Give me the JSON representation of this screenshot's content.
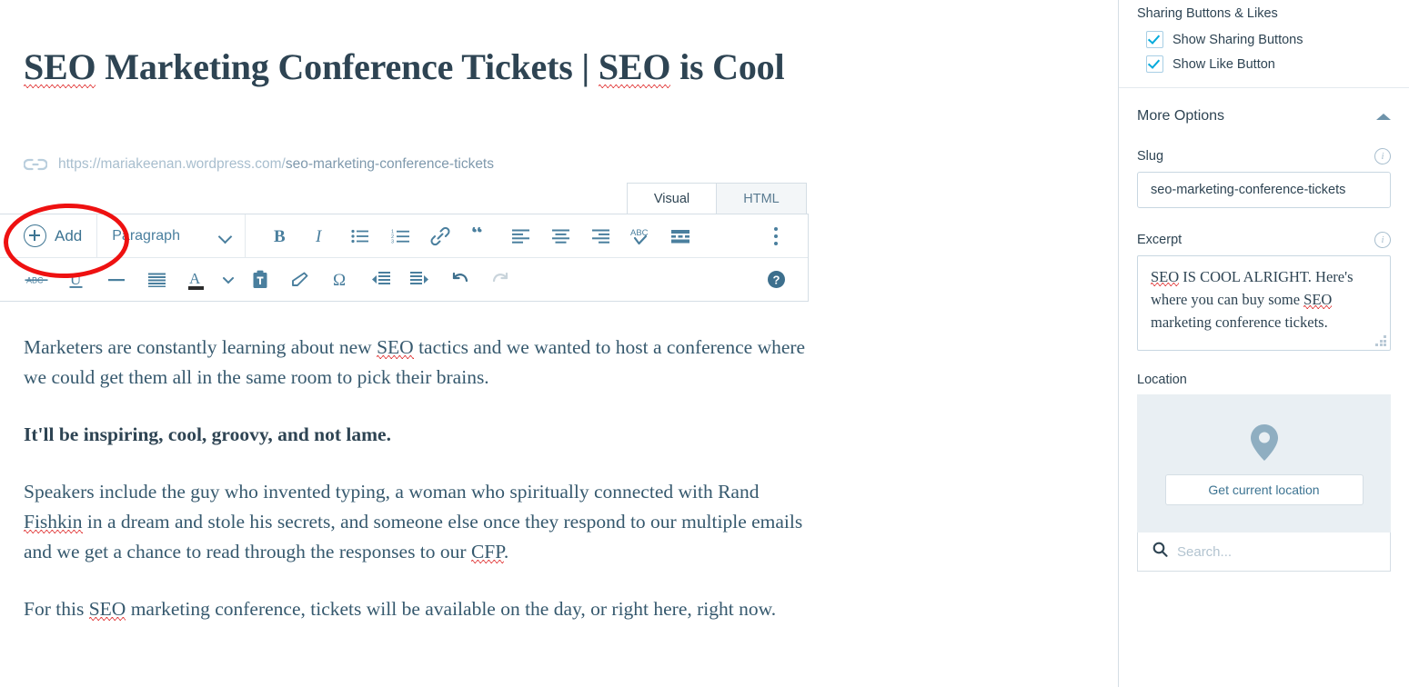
{
  "editor": {
    "title_line1": "SEO Marketing Conference Tickets | SEO",
    "title_line2": "is Cool",
    "title_full": "SEO Marketing Conference Tickets | SEO is Cool",
    "permalink_base": "https://mariakeenan.wordpress.com/",
    "permalink_slug": "seo-marketing-conference-tickets",
    "link_icon": "link-icon",
    "tabs": [
      {
        "label": "Visual",
        "active": true
      },
      {
        "label": "HTML",
        "active": false
      }
    ],
    "toolbar": {
      "add_label": "Add",
      "add_icon": "plus-circle-icon",
      "format_select_value": "Paragraph",
      "format_chevron_icon": "chevron-down-icon",
      "kebab_icon": "kebab-menu-icon",
      "help_icon": "help-icon",
      "row1_icons": [
        "bold-icon",
        "italic-icon",
        "bulleted-list-icon",
        "numbered-list-icon",
        "link-icon",
        "blockquote-icon",
        "align-left-icon",
        "align-center-icon",
        "align-right-icon",
        "spellcheck-icon",
        "insert-more-icon"
      ],
      "row2_icons": [
        "strikethrough-icon",
        "underline-icon",
        "horizontal-rule-icon",
        "justify-icon",
        "text-color-icon",
        "color-chevron-icon",
        "paste-icon",
        "clear-formatting-icon",
        "special-character-icon",
        "outdent-icon",
        "indent-icon",
        "undo-icon",
        "redo-icon"
      ]
    },
    "body_paragraphs": [
      {
        "text": "Marketers are constantly learning about new SEO tactics and we wanted to host a conference where we could get them all in the same room to pick their brains.",
        "bold": false
      },
      {
        "text": "It'll be inspiring, cool, groovy, and not lame.",
        "bold": true
      },
      {
        "text": "Speakers include the guy who invented typing, a woman who spiritually connected with Rand Fishkin in a dream and stole his secrets, and someone else once they respond to our multiple emails and we get a chance to read through the responses to our CFP.",
        "bold": false
      },
      {
        "text": "For this SEO marketing conference, tickets will be available on the day, or right here, right now.",
        "bold": false
      }
    ]
  },
  "annotation": {
    "shape": "ellipse",
    "color": "#ee1111",
    "targets": "add-button"
  },
  "sidebar": {
    "sharing": {
      "title": "Sharing Buttons & Likes",
      "options": [
        {
          "label": "Show Sharing Buttons",
          "checked": true
        },
        {
          "label": "Show Like Button",
          "checked": true
        }
      ]
    },
    "more_options": {
      "label": "More Options",
      "collapse_icon": "triangle-up-icon",
      "expanded": true
    },
    "slug": {
      "label": "Slug",
      "info_icon": "info-icon",
      "value": "seo-marketing-conference-tickets"
    },
    "excerpt": {
      "label": "Excerpt",
      "info_icon": "info-icon",
      "value": "SEO IS COOL ALRIGHT. Here's where you can buy some SEO marketing conference tickets."
    },
    "location": {
      "label": "Location",
      "pin_icon": "map-pin-icon",
      "get_location_label": "Get current location",
      "search_icon": "search-icon",
      "search_placeholder": "Search..."
    }
  },
  "colors": {
    "accent_blue": "#4a7f9e",
    "text_dark": "#2e4453",
    "body_text": "#36596e",
    "annotation_red": "#ee1111",
    "checkbox_check": "#00aadc",
    "border": "#d5dee5",
    "map_bg": "#e9eff3"
  }
}
